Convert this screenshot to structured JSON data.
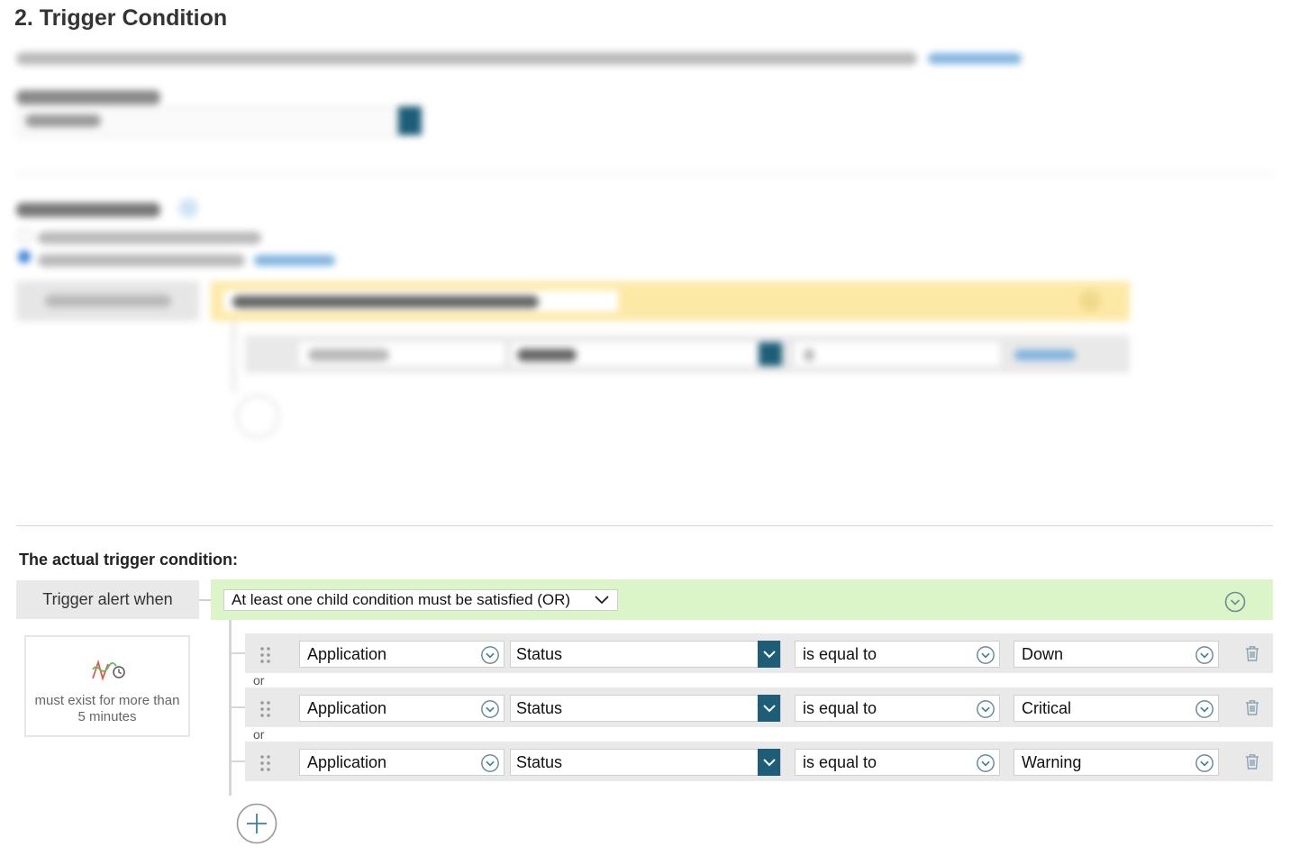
{
  "section": {
    "title": "2. Trigger Condition"
  },
  "actual": {
    "heading": "The actual trigger condition:",
    "trigger_when_label": "Trigger alert when",
    "group_select_value": "At least one child condition must be satisfied (OR)",
    "duration_text": "must exist for more than 5 minutes",
    "or_label": "or",
    "rows": [
      {
        "object": "Application",
        "property": "Status",
        "operator": "is equal to",
        "value": "Down"
      },
      {
        "object": "Application",
        "property": "Status",
        "operator": "is equal to",
        "value": "Critical"
      },
      {
        "object": "Application",
        "property": "Status",
        "operator": "is equal to",
        "value": "Warning"
      }
    ]
  },
  "colors": {
    "green_group": "#dcf5c8",
    "yellow_group": "#fde9a6",
    "accent_dark": "#1d5d77",
    "icon_blue": "#3c7fa3"
  },
  "icons": {
    "drag": "drag-handle-icon",
    "dropdown": "chevron-circle-icon",
    "delete": "trash-icon",
    "add": "plus-circle-icon",
    "duration": "time-condition-icon"
  }
}
